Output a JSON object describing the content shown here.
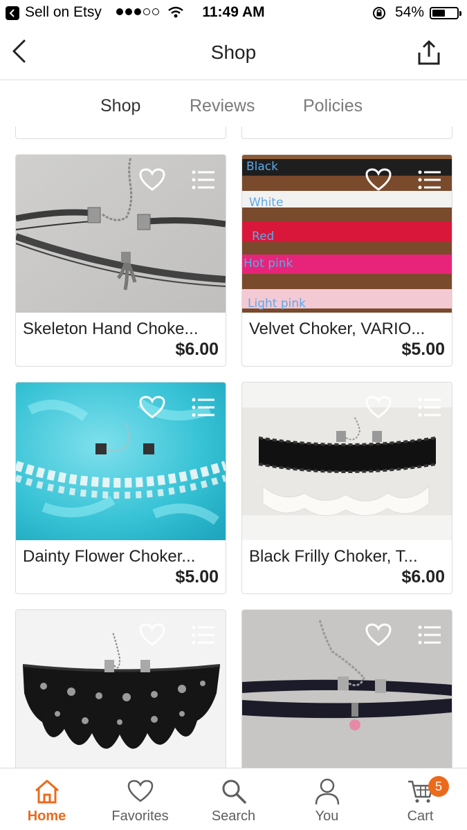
{
  "status_bar": {
    "app_name": "Sell on Etsy",
    "time": "11:49 AM",
    "battery": "54%",
    "battery_level": 0.54
  },
  "nav": {
    "title": "Shop"
  },
  "tabs": [
    {
      "label": "Shop",
      "active": true
    },
    {
      "label": "Reviews",
      "active": false
    },
    {
      "label": "Policies",
      "active": false
    }
  ],
  "listings": [
    {
      "title": "Skeleton Hand Choke...",
      "price": "$6.00",
      "image": "skeleton-hand-choker-photo"
    },
    {
      "title": "Velvet Choker, VARIO...",
      "price": "$5.00",
      "image": "velvet-choker-colors-photo",
      "image_labels": [
        "Black",
        "White",
        "Red",
        "Hot pink",
        "Light pink"
      ]
    },
    {
      "title": "Dainty Flower Choker...",
      "price": "$5.00",
      "image": "flower-choker-photo"
    },
    {
      "title": "Black Frilly Choker, T...",
      "price": "$6.00",
      "image": "frilly-choker-photo"
    },
    {
      "title": "",
      "price": "",
      "image": "lace-choker-photo"
    },
    {
      "title": "",
      "price": "",
      "image": "velvet-pink-bead-choker-photo"
    }
  ],
  "tab_bar": {
    "items": [
      {
        "label": "Home",
        "icon": "home-icon",
        "active": true
      },
      {
        "label": "Favorites",
        "icon": "heart-icon",
        "active": false
      },
      {
        "label": "Search",
        "icon": "search-icon",
        "active": false
      },
      {
        "label": "You",
        "icon": "person-icon",
        "active": false
      },
      {
        "label": "Cart",
        "icon": "cart-icon",
        "active": false
      }
    ],
    "cart_count": "5"
  },
  "colors": {
    "accent": "#ec6a1c",
    "border": "#dcdcdc"
  }
}
